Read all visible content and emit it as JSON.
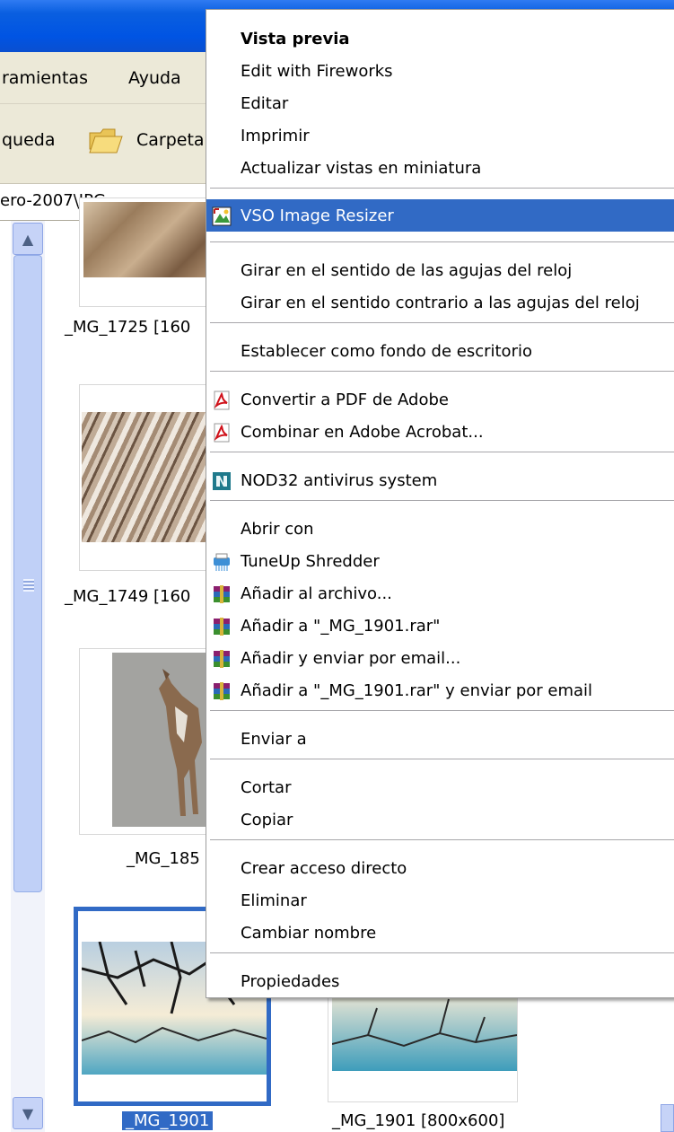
{
  "menubar": {
    "herramientas": "ramientas",
    "ayuda": "Ayuda"
  },
  "toolbar": {
    "busqueda": "queda",
    "carpetas": "Carpeta"
  },
  "address": {
    "path": "ero-2007\\JPG"
  },
  "thumbnails": [
    {
      "caption": "_MG_1725 [160"
    },
    {
      "caption": "_MG_1749 [160"
    },
    {
      "caption": "_MG_185"
    },
    {
      "caption": "_MG_1901",
      "selected": true
    },
    {
      "caption": "_MG_1901 [800x600]"
    }
  ],
  "context_menu": {
    "items": [
      {
        "label": "Vista previa",
        "bold": true
      },
      {
        "label": "Edit with Fireworks"
      },
      {
        "label": "Editar"
      },
      {
        "label": "Imprimir"
      },
      {
        "label": "Actualizar vistas en miniatura"
      },
      {
        "label": "VSO Image Resizer",
        "icon": "vso-resizer-icon",
        "highlighted": true
      },
      {
        "label": "Girar en el sentido de las agujas del reloj"
      },
      {
        "label": "Girar en el sentido contrario a las agujas del reloj"
      },
      {
        "label": "Establecer como fondo de escritorio"
      },
      {
        "label": "Convertir a PDF de Adobe",
        "icon": "pdf-icon"
      },
      {
        "label": "Combinar en Adobe Acrobat...",
        "icon": "pdf-icon"
      },
      {
        "label": "NOD32 antivirus system",
        "icon": "nod32-icon"
      },
      {
        "label": "Abrir con"
      },
      {
        "label": "TuneUp Shredder",
        "icon": "shredder-icon"
      },
      {
        "label": "Añadir al archivo...",
        "icon": "winrar-icon"
      },
      {
        "label": "Añadir a \"_MG_1901.rar\"",
        "icon": "winrar-icon"
      },
      {
        "label": "Añadir y enviar por email...",
        "icon": "winrar-icon"
      },
      {
        "label": "Añadir a \"_MG_1901.rar\" y enviar por email",
        "icon": "winrar-icon"
      },
      {
        "label": "Enviar a"
      },
      {
        "label": "Cortar"
      },
      {
        "label": "Copiar"
      },
      {
        "label": "Crear acceso directo"
      },
      {
        "label": "Eliminar"
      },
      {
        "label": "Cambiar nombre"
      },
      {
        "label": "Propiedades"
      }
    ],
    "highlight_color": "#316ac5"
  },
  "colors": {
    "titlebar": "#0054e3",
    "chrome": "#ece9d8",
    "selection": "#316ac5"
  }
}
